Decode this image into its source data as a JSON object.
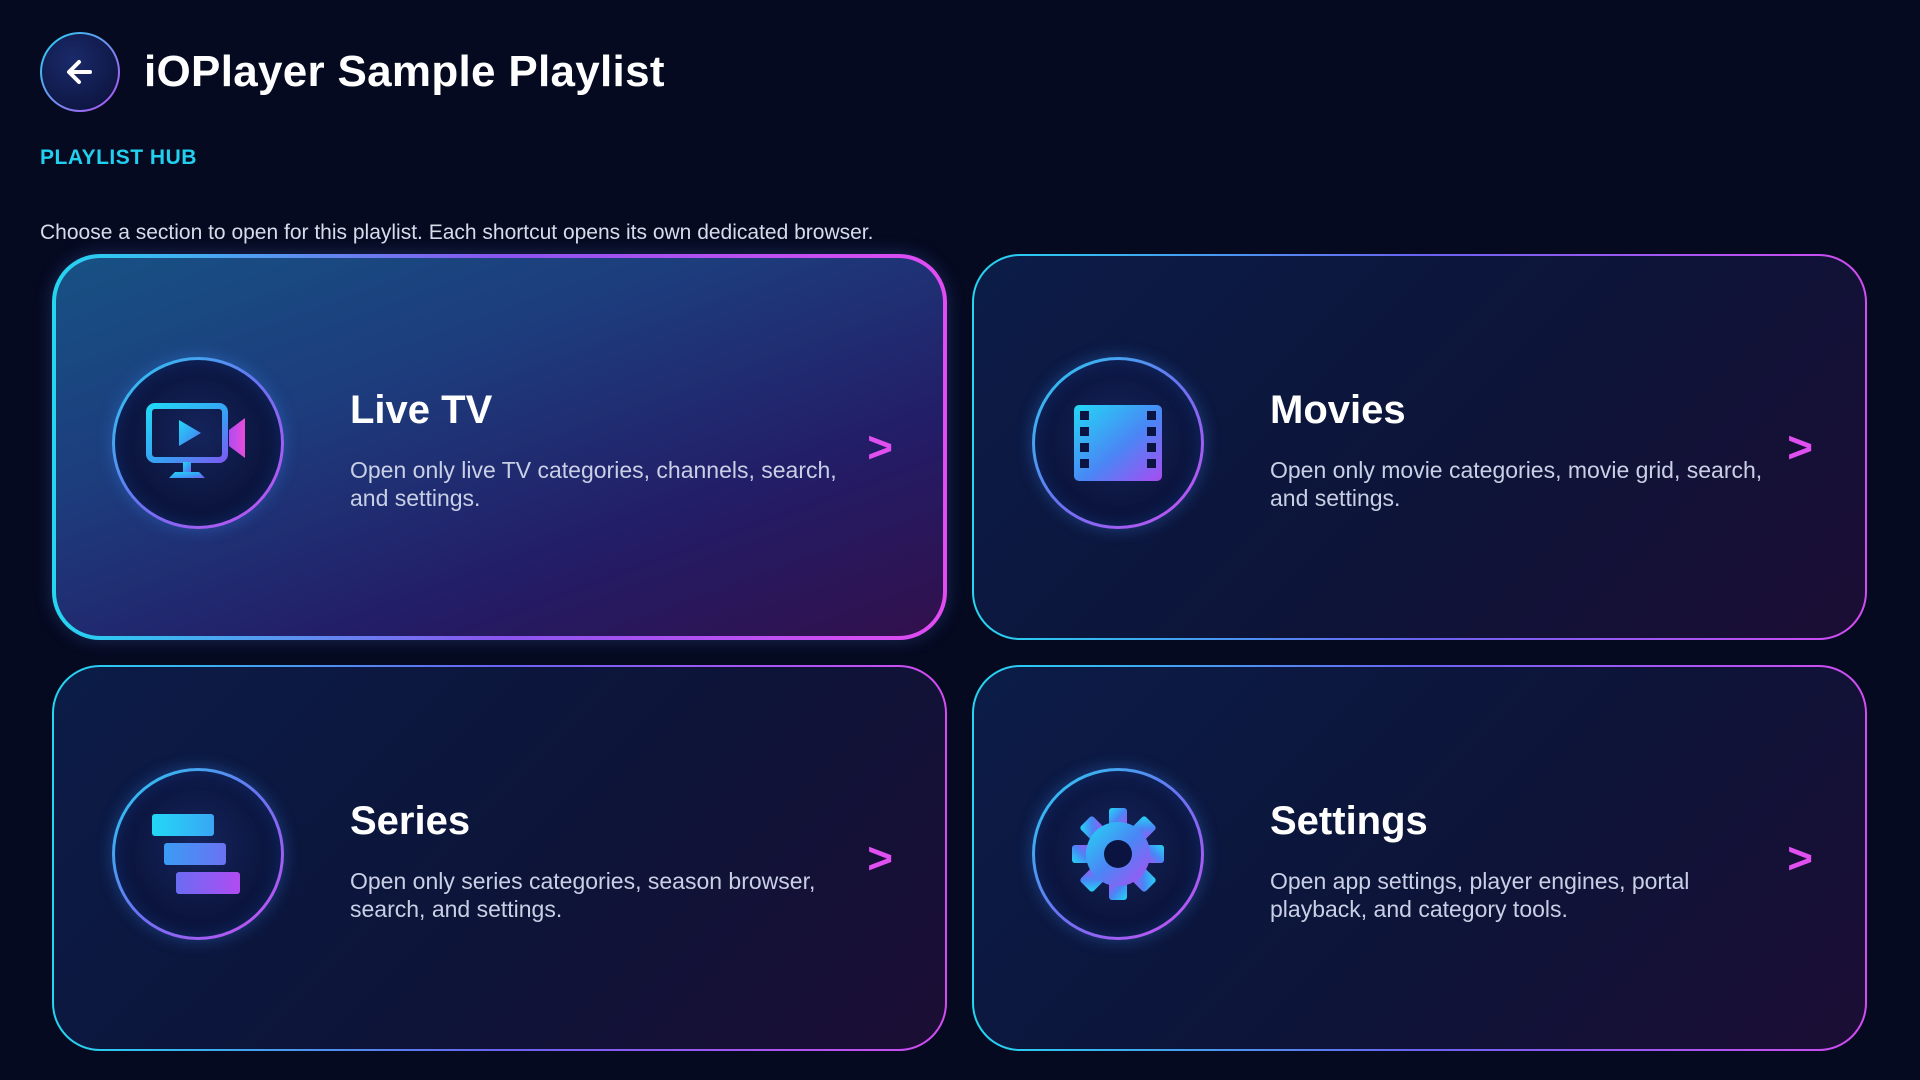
{
  "header": {
    "title": "iOPlayer Sample Playlist",
    "back_icon": "arrow-left-icon"
  },
  "hub_label": "PLAYLIST HUB",
  "subtitle": "Choose a section to open for this playlist. Each shortcut opens its own dedicated browser.",
  "cards": [
    {
      "id": "live-tv",
      "title": "Live TV",
      "description": "Open only live TV categories, channels, search, and settings.",
      "icon": "tv-camera-icon",
      "chevron": ">",
      "focused": true
    },
    {
      "id": "movies",
      "title": "Movies",
      "description": "Open only movie categories, movie grid, search, and settings.",
      "icon": "film-strip-icon",
      "chevron": ">",
      "focused": false
    },
    {
      "id": "series",
      "title": "Series",
      "description": "Open only series categories, season browser, search, and settings.",
      "icon": "stacked-bars-icon",
      "chevron": ">",
      "focused": false
    },
    {
      "id": "settings",
      "title": "Settings",
      "description": "Open app settings, player engines, portal playback, and category tools.",
      "icon": "gear-icon",
      "chevron": ">",
      "focused": false
    }
  ],
  "colors": {
    "background": "#050a20",
    "accent_cyan": "#22cfee",
    "accent_magenta": "#e04ff0",
    "text_secondary": "#c9d0e6"
  }
}
